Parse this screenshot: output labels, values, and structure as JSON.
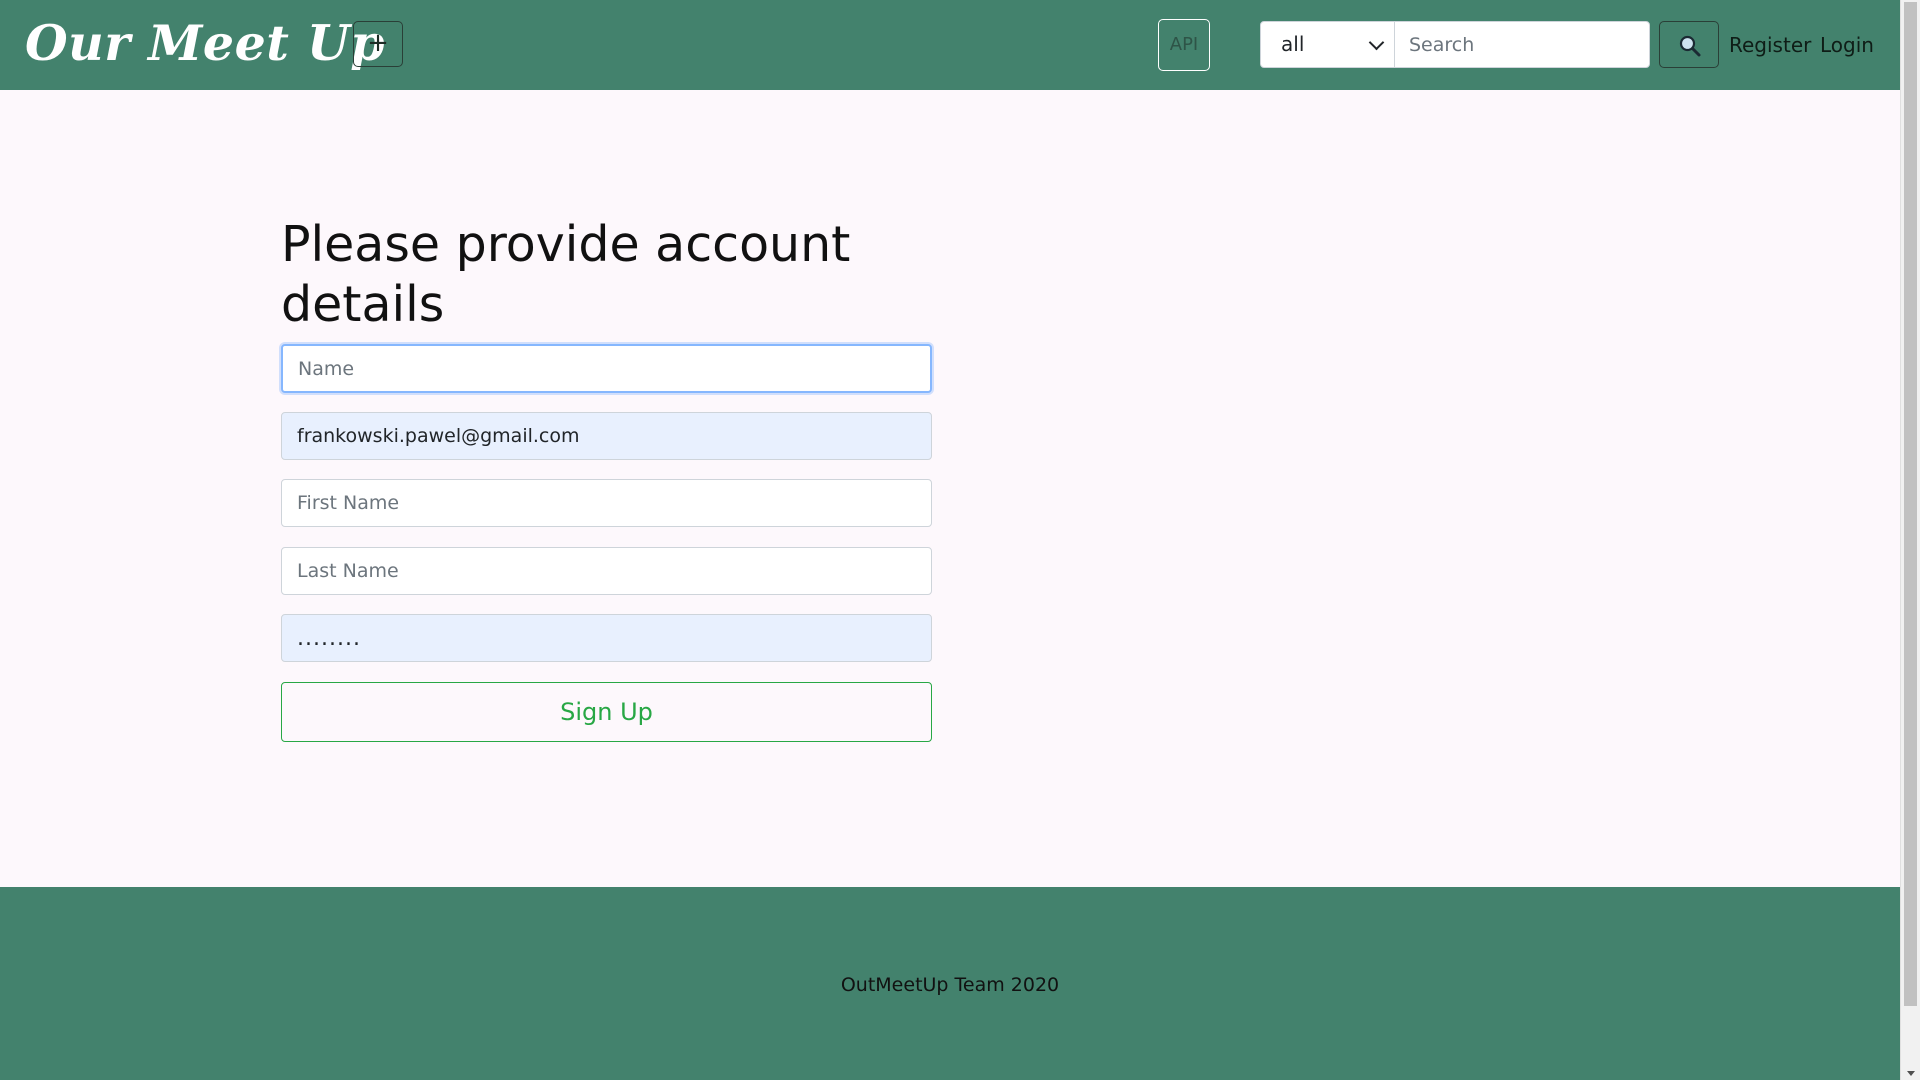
{
  "navbar": {
    "brand": "Our Meet Up",
    "add_label": "+",
    "api_label": "API",
    "category_selected": "all",
    "search_placeholder": "Search",
    "register_label": "Register",
    "login_label": "Login"
  },
  "form": {
    "heading": "Please provide account details",
    "name_placeholder": "Name",
    "email_value": "frankowski.pawel@gmail.com",
    "first_name_placeholder": "First Name",
    "last_name_placeholder": "Last Name",
    "password_value": "........",
    "submit_label": "Sign Up"
  },
  "footer": {
    "text": "OutMeetUp Team 2020"
  },
  "colors": {
    "brand_green": "#43826d",
    "success_green": "#28a745",
    "autofill_bg": "#e8f0fe",
    "page_bg": "#fdf8fc"
  },
  "icons": {
    "search": "magnifier-icon",
    "add": "plus-icon",
    "dropdown": "chevron-down-icon"
  }
}
